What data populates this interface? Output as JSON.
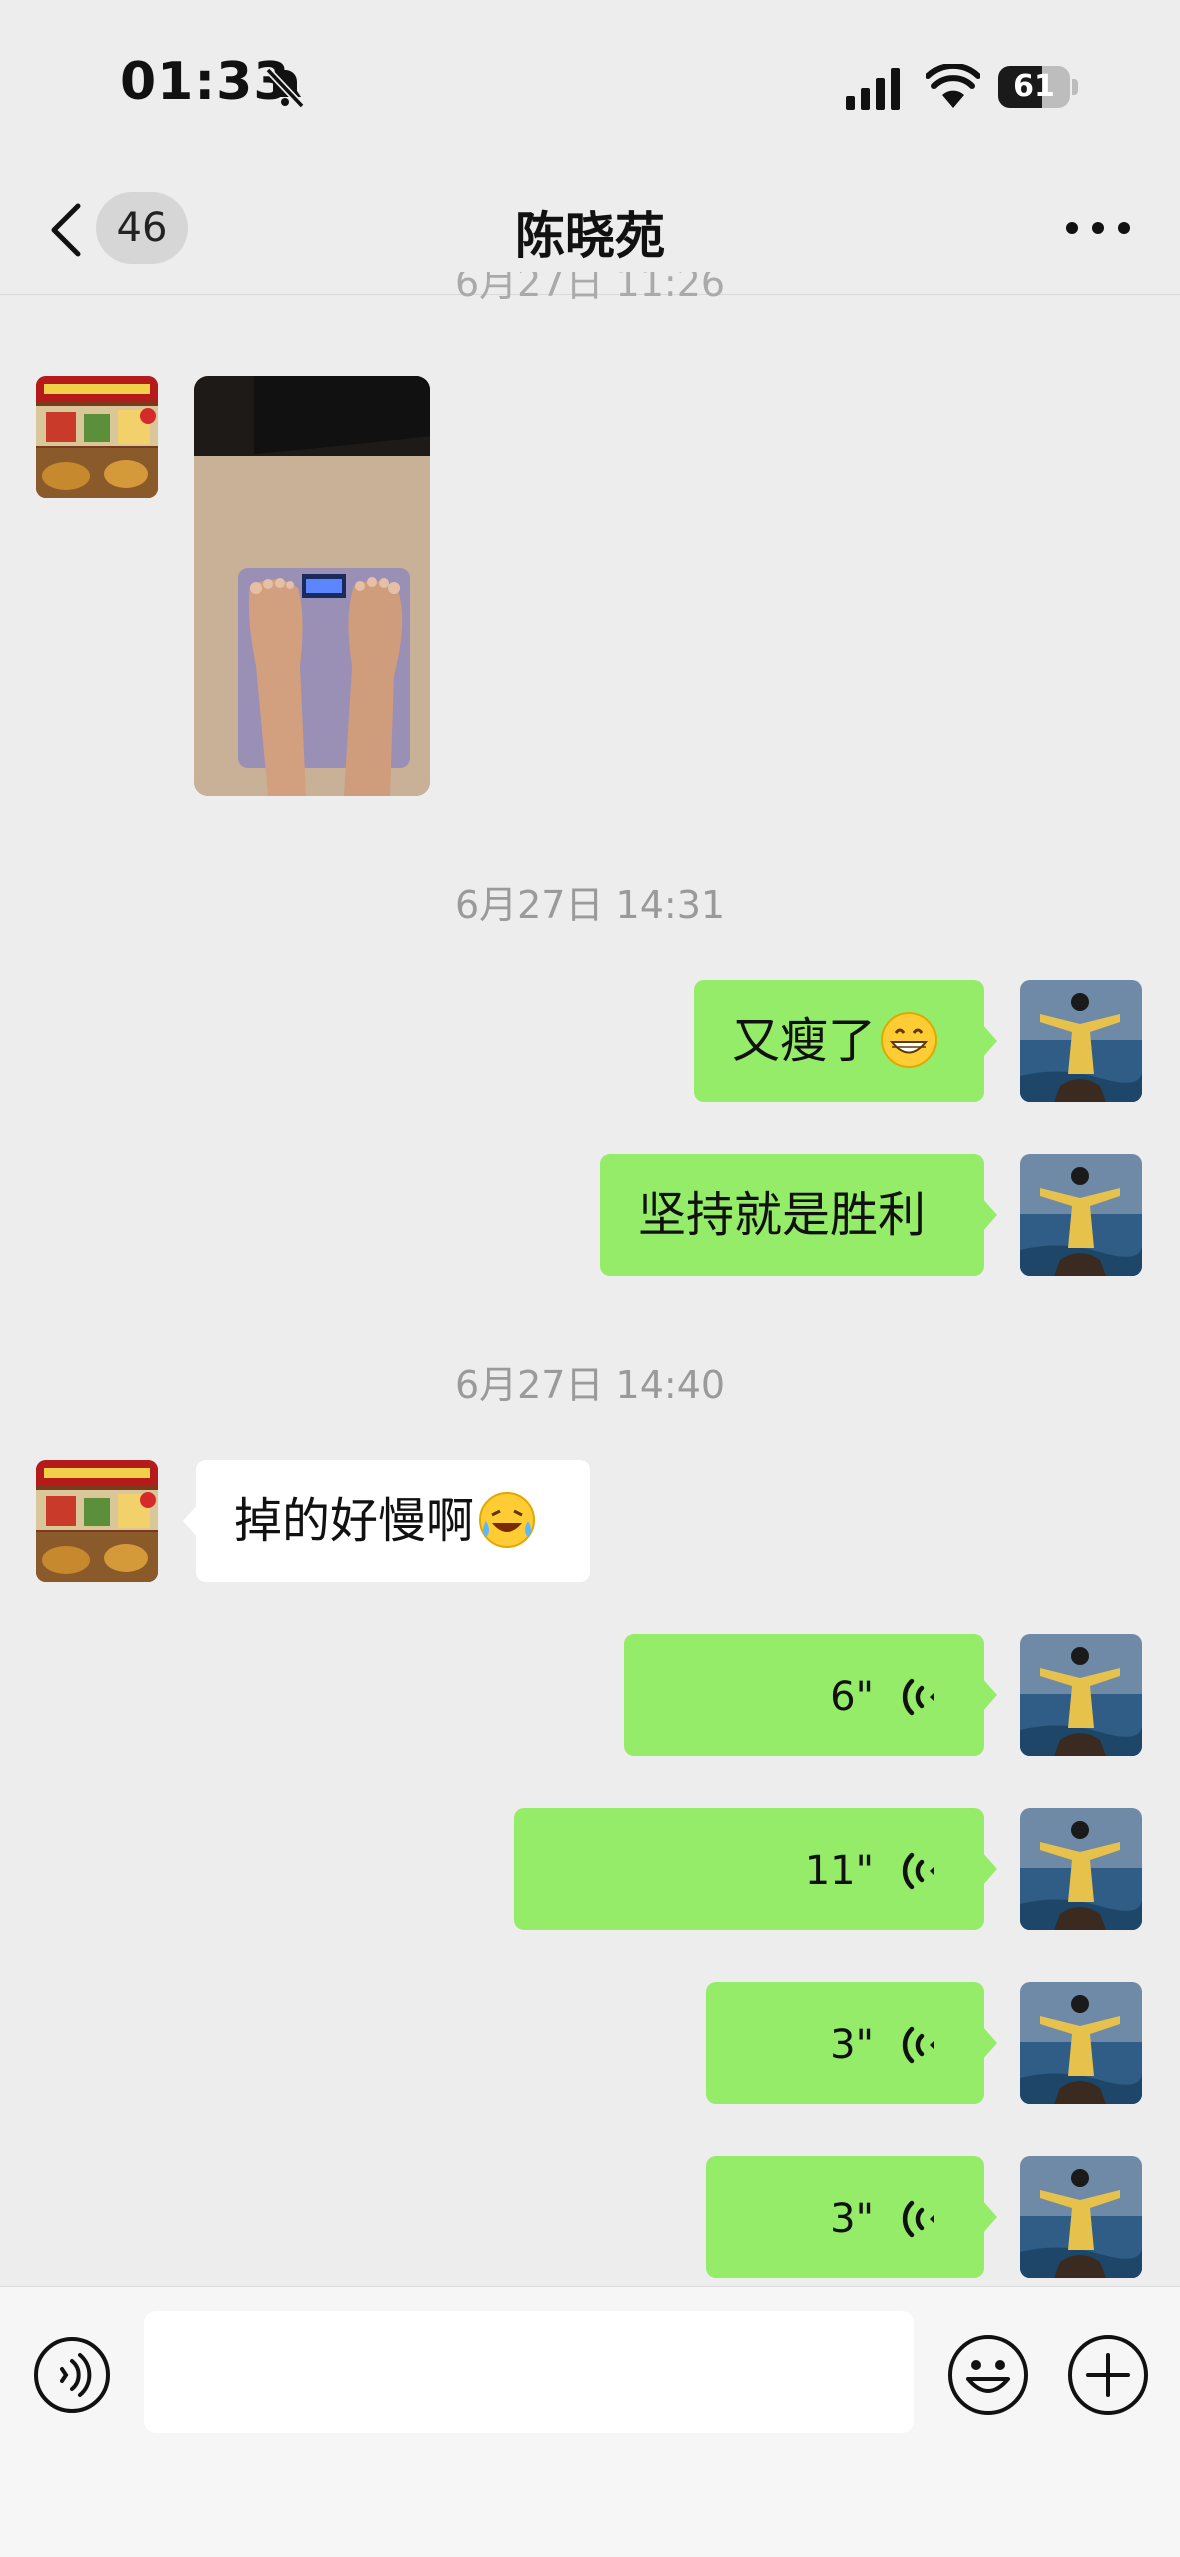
{
  "status": {
    "time": "01:33",
    "battery": "61",
    "battery_level": 0.61
  },
  "nav": {
    "unread_count": "46",
    "title": "陈晓苑"
  },
  "messages": {
    "clipped_timestamp": "6月27日 11:26",
    "ts1": "6月27日 14:31",
    "m1": "又瘦了",
    "m2": "坚持就是胜利",
    "ts2": "6月27日 14:40",
    "m3": "掉的好慢啊",
    "voice1": "6\"",
    "voice2": "11\"",
    "voice3": "3\"",
    "voice4": "3\""
  },
  "icons": {
    "back": "chevron-left-icon",
    "more": "more-icon",
    "voice": "voice-mode-icon",
    "emoji": "emoji-icon",
    "plus": "plus-icon",
    "bell": "bell-slash-icon"
  },
  "colors": {
    "my_bubble": "#95ec69",
    "other_bubble": "#ffffff",
    "background": "#ededed"
  }
}
